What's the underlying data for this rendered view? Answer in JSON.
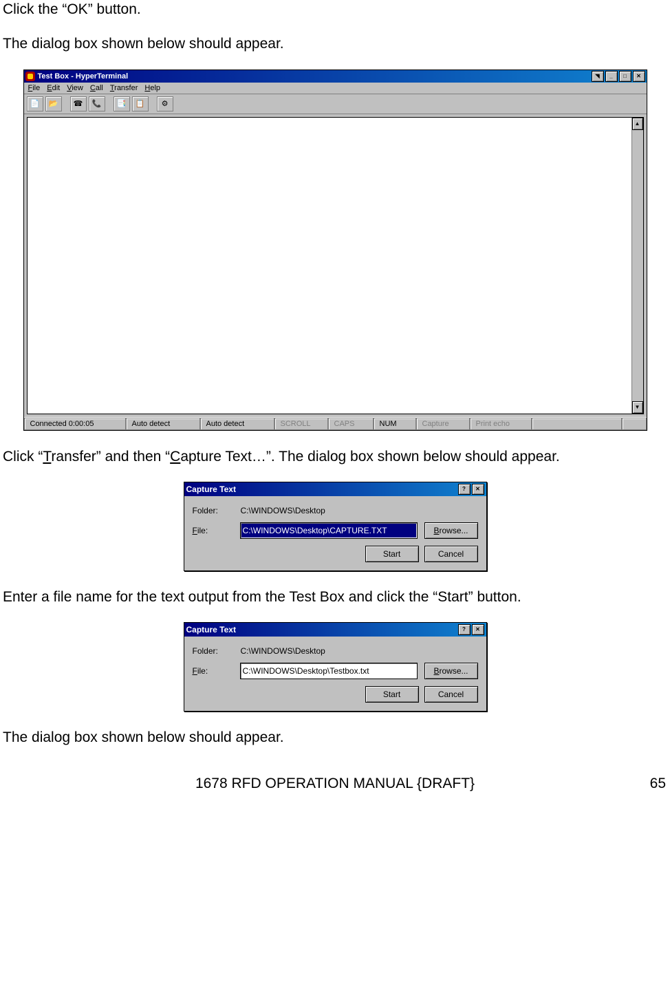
{
  "paragraphs": {
    "p1": "Click the “OK” button.",
    "p2": "The dialog box shown below should appear.",
    "p3_pre": "Click “",
    "p3_u1": "T",
    "p3_mid1": "ransfer” and then “",
    "p3_u2": "C",
    "p3_mid2": "apture Text…”.  The dialog box shown below should appear.",
    "p4": "Enter a file name for the text output from the Test Box and click the “Start” button.",
    "p5": "The dialog box shown below should appear."
  },
  "hyperterminal": {
    "title": "Test Box - HyperTerminal",
    "menus": {
      "file_u": "F",
      "file_r": "ile",
      "edit_u": "E",
      "edit_r": "dit",
      "view_u": "V",
      "view_r": "iew",
      "call_u": "C",
      "call_r": "all",
      "transfer_u": "T",
      "transfer_r": "ransfer",
      "help_u": "H",
      "help_r": "elp"
    },
    "status": {
      "connected": "Connected 0:00:05",
      "auto1": "Auto detect",
      "auto2": "Auto detect",
      "scroll": "SCROLL",
      "caps": "CAPS",
      "num": "NUM",
      "capture": "Capture",
      "printecho": "Print echo"
    }
  },
  "capture1": {
    "title": "Capture Text",
    "folder_label": "Folder:",
    "folder_value": "C:\\WINDOWS\\Desktop",
    "file_label_u": "F",
    "file_label_r": "ile:",
    "file_value": "C:\\WINDOWS\\Desktop\\CAPTURE.TXT",
    "browse_u": "B",
    "browse_r": "rowse...",
    "start": "Start",
    "cancel": "Cancel"
  },
  "capture2": {
    "title": "Capture Text",
    "folder_label": "Folder:",
    "folder_value": "C:\\WINDOWS\\Desktop",
    "file_label_u": "F",
    "file_label_r": "ile:",
    "file_value": "C:\\WINDOWS\\Desktop\\Testbox.txt",
    "browse_u": "B",
    "browse_r": "rowse...",
    "start": "Start",
    "cancel": "Cancel"
  },
  "footer": {
    "doc_title": "1678 RFD OPERATION MANUAL {DRAFT}",
    "page_num": "65"
  }
}
